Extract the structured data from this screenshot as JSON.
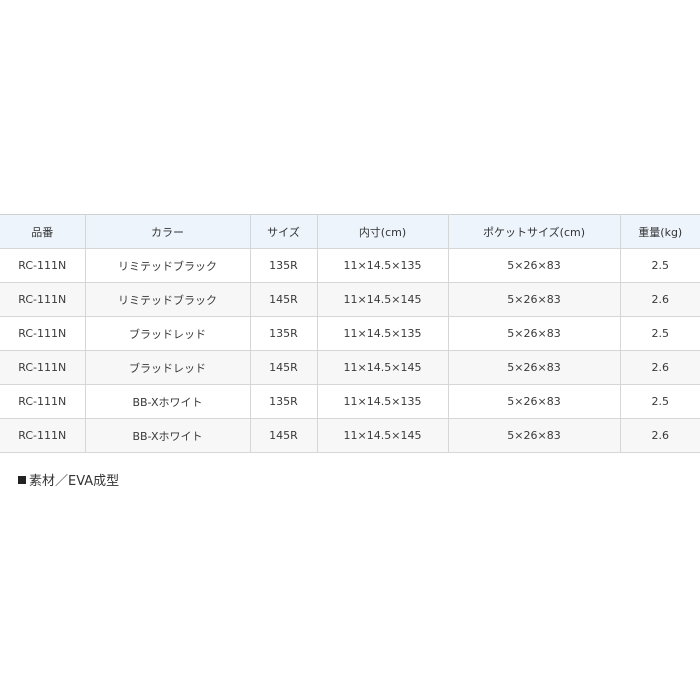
{
  "spec_table": {
    "headers": [
      "品番",
      "カラー",
      "サイズ",
      "内寸(cm)",
      "ポケットサイズ(cm)",
      "重量(kg)"
    ],
    "rows": [
      [
        "RC-111N",
        "リミテッドブラック",
        "135R",
        "11×14.5×135",
        "5×26×83",
        "2.5"
      ],
      [
        "RC-111N",
        "リミテッドブラック",
        "145R",
        "11×14.5×145",
        "5×26×83",
        "2.6"
      ],
      [
        "RC-111N",
        "ブラッドレッド",
        "135R",
        "11×14.5×135",
        "5×26×83",
        "2.5"
      ],
      [
        "RC-111N",
        "ブラッドレッド",
        "145R",
        "11×14.5×145",
        "5×26×83",
        "2.6"
      ],
      [
        "RC-111N",
        "BB-Xホワイト",
        "135R",
        "11×14.5×135",
        "5×26×83",
        "2.5"
      ],
      [
        "RC-111N",
        "BB-Xホワイト",
        "145R",
        "11×14.5×145",
        "5×26×83",
        "2.6"
      ]
    ]
  },
  "material_note": {
    "text": "素材／EVA成型"
  },
  "colors": {
    "header_background": "#eef4fc",
    "border": "#d6d6d6",
    "row_alt_background": "#f7f7f7"
  },
  "icons": {
    "material_bullet": "square-bullet-icon"
  }
}
